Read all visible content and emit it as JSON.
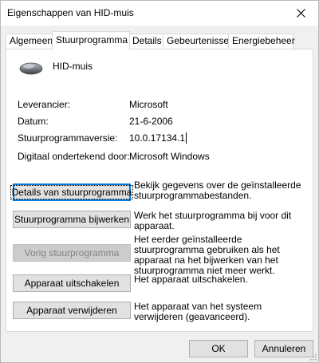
{
  "window": {
    "title": "Eigenschappen van HID-muis"
  },
  "tabs": [
    {
      "label": "Algemeen"
    },
    {
      "label": "Stuurprogramma"
    },
    {
      "label": "Details"
    },
    {
      "label": "Gebeurtenissen"
    },
    {
      "label": "Energiebeheer"
    }
  ],
  "active_tab": "Stuurprogramma",
  "device": {
    "name": "HID-muis",
    "icon": "mouse-icon"
  },
  "properties": [
    {
      "label": "Leverancier:",
      "value": "Microsoft"
    },
    {
      "label": "Datum:",
      "value": "21-6-2006"
    },
    {
      "label": "Stuurprogrammaversie:",
      "value": "10.0.17134.1"
    },
    {
      "label": "Digitaal ondertekend door:",
      "value": "Microsoft Windows"
    }
  ],
  "actions": [
    {
      "label": "Details van stuurprogramma",
      "description": "Bekijk gegevens over de geïnstalleerde stuurprogrammabestanden.",
      "enabled": true,
      "focused": true
    },
    {
      "label": "Stuurprogramma bijwerken",
      "description": "Werk het stuurprogramma bij voor dit apparaat.",
      "enabled": true
    },
    {
      "label": "Vorig stuurprogramma",
      "description": "Het eerder geïnstalleerde stuurprogramma gebruiken als het apparaat na het bijwerken van het stuurprogramma niet meer werkt.",
      "enabled": false
    },
    {
      "label": "Apparaat uitschakelen",
      "description": "Het apparaat uitschakelen.",
      "enabled": true
    },
    {
      "label": "Apparaat verwijderen",
      "description": "Het apparaat van het systeem verwijderen (geavanceerd).",
      "enabled": true
    }
  ],
  "footer": {
    "ok_label": "OK",
    "cancel_label": "Annuleren"
  },
  "colors": {
    "focus_border": "#0078d7",
    "disabled_text": "#838383"
  }
}
